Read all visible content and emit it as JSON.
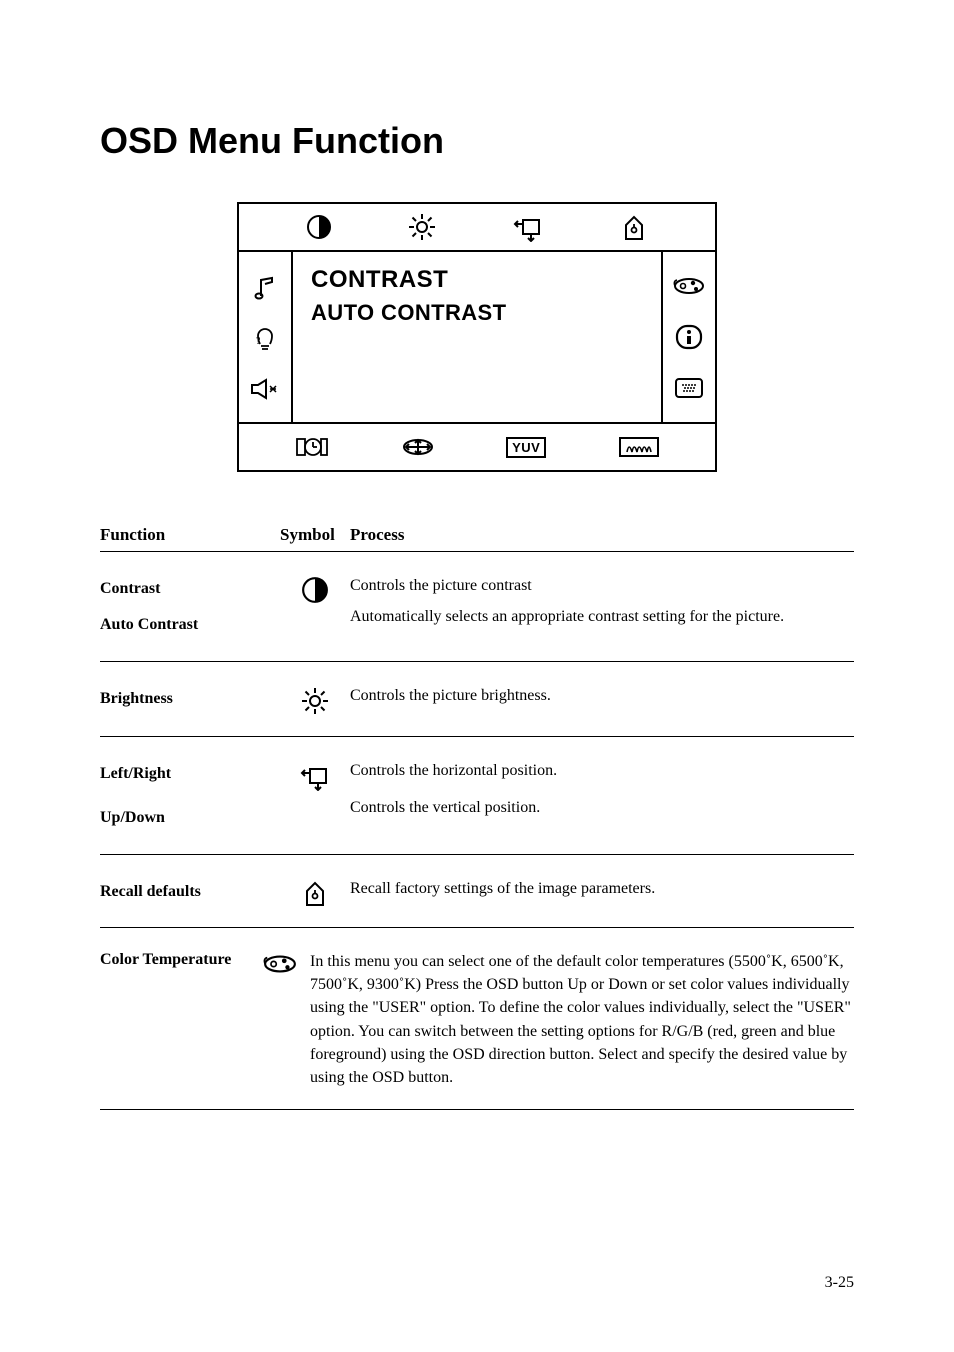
{
  "page": {
    "title": "OSD Menu Function",
    "page_number": "3-25"
  },
  "osd": {
    "center_line1": "CONTRAST",
    "center_line2": "AUTO CONTRAST",
    "yuv_label": "YUV"
  },
  "table": {
    "headers": {
      "function": "Function",
      "symbol": "Symbol",
      "process": "Process"
    },
    "rows": [
      {
        "func1": "Contrast",
        "func2": "Auto Contrast",
        "proc1": "Controls the picture contrast",
        "proc2": "Automatically selects an appropriate contrast setting for the picture."
      },
      {
        "func1": "Brightness",
        "proc1": "Controls the picture brightness."
      },
      {
        "func1": "Left/Right",
        "func2": "Up/Down",
        "proc1": "Controls the horizontal position.",
        "proc2": "Controls the vertical position."
      },
      {
        "func1": "Recall defaults",
        "proc1": "Recall factory settings of the image parameters."
      },
      {
        "func1": "Color Temperature",
        "proc1": "In this menu you can select one of the default color temperatures (5500˚K, 6500˚K,  7500˚K,  9300˚K) Press the OSD button Up or Down or set color values individually using the \"USER\" option. To define the color values individually, select the \"USER\" option. You can switch between the setting options for R/G/B (red, green and blue foreground) using the OSD direction button. Select and specify the desired value by using the OSD button."
      }
    ]
  }
}
